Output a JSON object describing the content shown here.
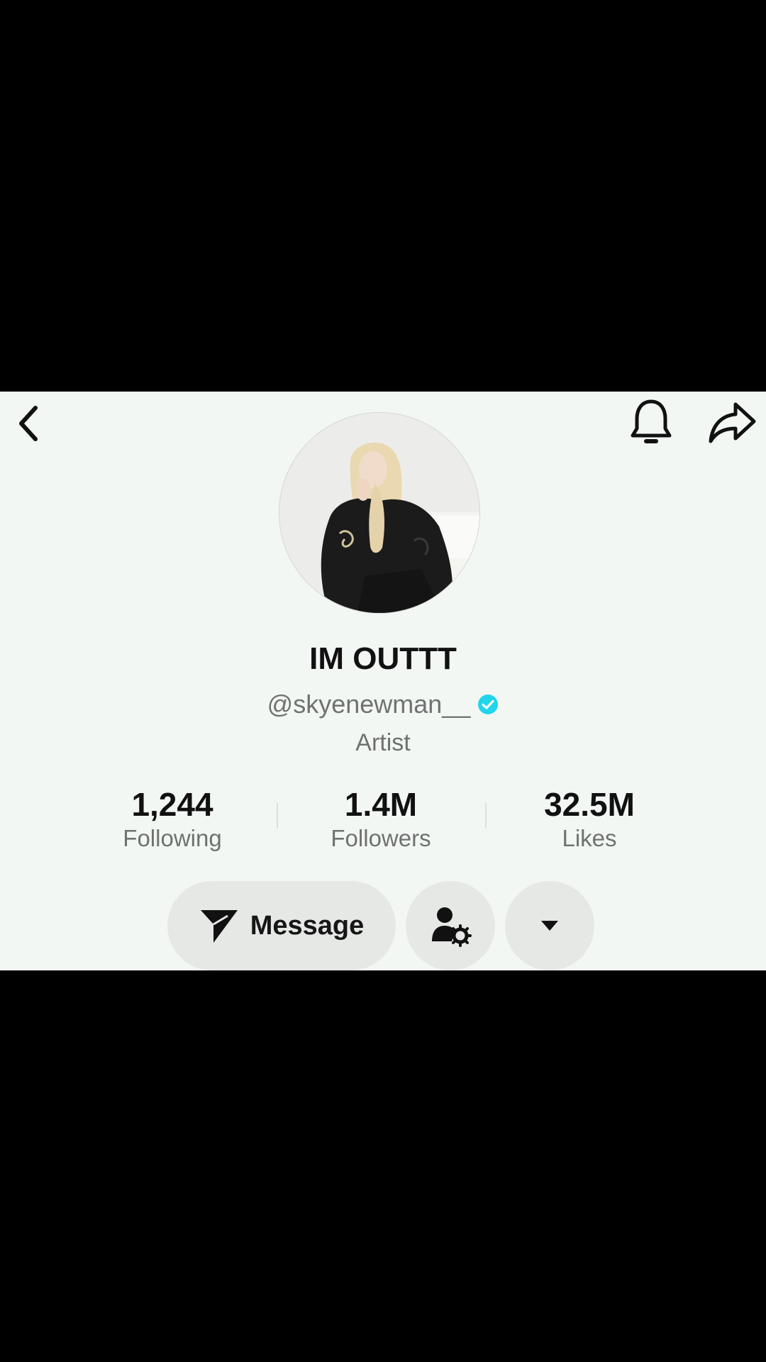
{
  "header": {
    "back_icon": "chevron-left-icon",
    "notification_icon": "bell-icon",
    "share_icon": "share-arrow-icon"
  },
  "profile": {
    "display_name": "IM OUTTT",
    "handle": "@skyenewman__",
    "verified": true,
    "bio": "Artist",
    "avatar_description": "avatar-photo"
  },
  "stats": [
    {
      "value": "1,244",
      "label": "Following"
    },
    {
      "value": "1.4M",
      "label": "Followers"
    },
    {
      "value": "32.5M",
      "label": "Likes"
    }
  ],
  "actions": {
    "message_label": "Message",
    "message_icon": "send-icon",
    "profile_settings_icon": "user-gear-icon",
    "more_icon": "caret-down-icon"
  },
  "colors": {
    "panel_bg": "#f3f7f4",
    "verified": "#20d5ec",
    "button_bg": "#e6e8e6",
    "text_primary": "#111111",
    "text_secondary": "#6f7270"
  }
}
